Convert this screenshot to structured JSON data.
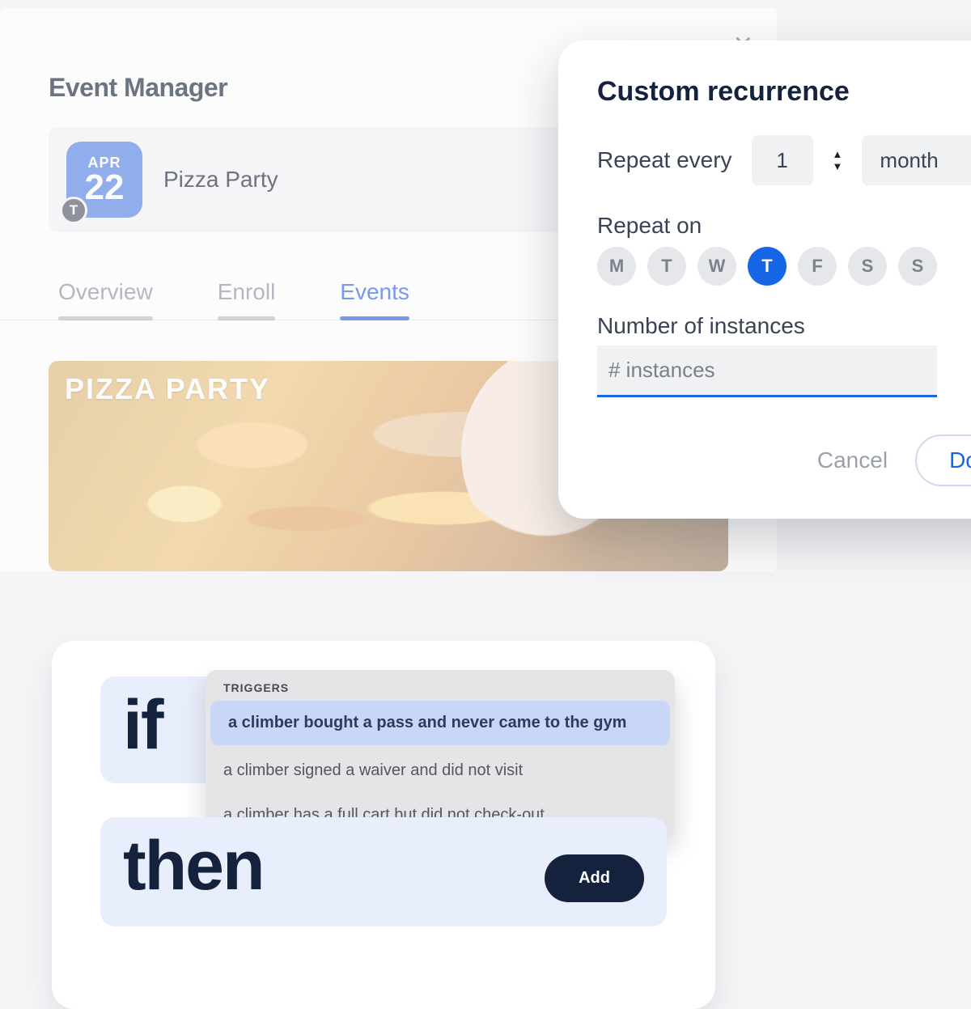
{
  "panel": {
    "title": "Event Manager",
    "close_glyph": "×"
  },
  "event": {
    "month": "APR",
    "day": "22",
    "type_badge": "T",
    "name": "Pizza Party"
  },
  "tabs": {
    "overview": "Overview",
    "enroll": "Enroll",
    "events": "Events"
  },
  "hero": {
    "title": "PIZZA PARTY"
  },
  "rules": {
    "if": "if",
    "then": "then",
    "add": "Add",
    "triggers_label": "TRIGGERS",
    "triggers": [
      "a climber bought a pass and never came to the gym",
      "a climber signed a waiver and did not visit",
      "a climber has a full cart but did not check-out"
    ]
  },
  "recurrence": {
    "title": "Custom recurrence",
    "repeat_every_label": "Repeat every",
    "interval": "1",
    "unit": "month",
    "repeat_on_label": "Repeat on",
    "days": [
      "M",
      "T",
      "W",
      "T",
      "F",
      "S",
      "S"
    ],
    "selected_day_index": 3,
    "instances_label": "Number of instances",
    "instances_placeholder": "# instances",
    "cancel": "Cancel",
    "done": "Done"
  }
}
